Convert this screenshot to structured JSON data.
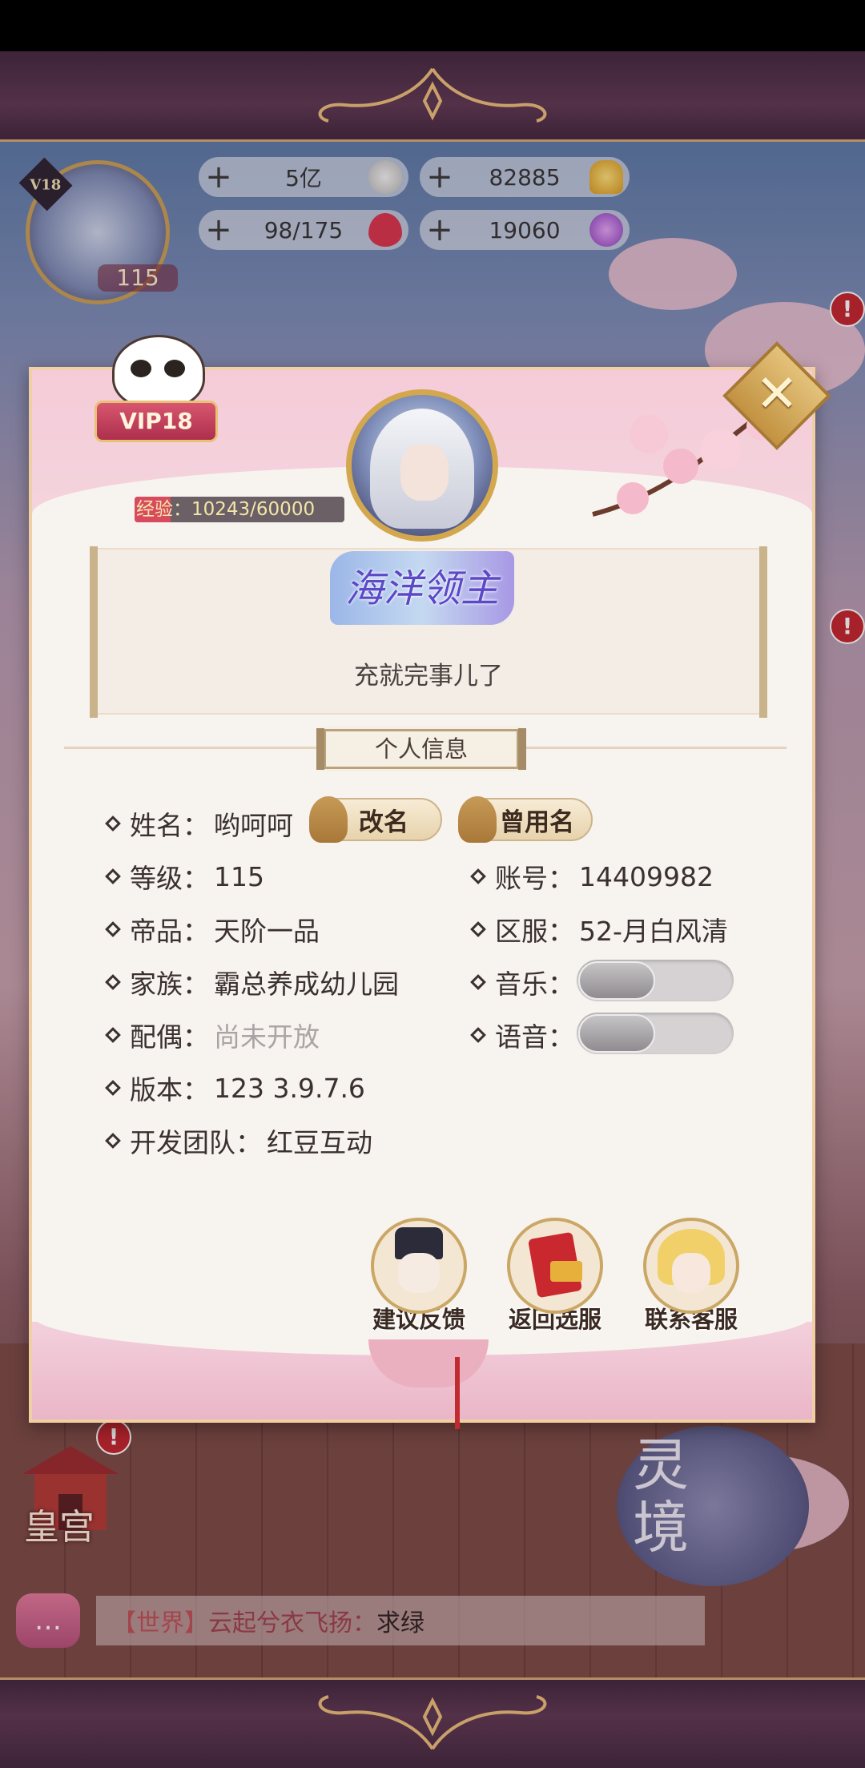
{
  "hud": {
    "vip": "V18",
    "level": "115",
    "resources": [
      {
        "value": "5亿",
        "icon": "silver-coin-icon",
        "color": "#d9d9d9"
      },
      {
        "value": "82885",
        "icon": "gold-ingot-icon",
        "color": "#e8b630"
      },
      {
        "value": "98/175",
        "icon": "heart-icon",
        "color": "#d9344a"
      },
      {
        "value": "19060",
        "icon": "purple-gem-icon",
        "color": "#9a4fc8"
      }
    ]
  },
  "panel": {
    "vip_badge": "VIP18",
    "exp_label": "经验：10243/60000",
    "exp_fraction": 0.17,
    "title_art": "海洋领主",
    "motto": "充就完事儿了",
    "section_title": "个人信息",
    "rename_button": "改名",
    "former_names_button": "曾用名",
    "info_left": [
      {
        "label": "姓名：",
        "value": "哟呵呵"
      },
      {
        "label": "等级：",
        "value": "115"
      },
      {
        "label": "帝品：",
        "value": "天阶一品"
      },
      {
        "label": "家族：",
        "value": "霸总养成幼儿园"
      },
      {
        "label": "配偶：",
        "value": "尚未开放"
      },
      {
        "label": "版本：",
        "value": "123 3.9.7.6"
      },
      {
        "label": "开发团队：",
        "value": "红豆互动"
      }
    ],
    "info_right": [
      {
        "label": "账号：",
        "value": "14409982"
      },
      {
        "label": "区服：",
        "value": "52-月白风清"
      },
      {
        "label": "音乐：",
        "toggle": "off"
      },
      {
        "label": "语音：",
        "toggle": "off"
      }
    ],
    "actions": [
      {
        "label": "建议反馈",
        "icon": "feedback-advisor-icon"
      },
      {
        "label": "返回选服",
        "icon": "server-select-book-icon"
      },
      {
        "label": "联系客服",
        "icon": "customer-service-icon"
      }
    ]
  },
  "background": {
    "palace_label": "皇宫",
    "spirit_label": "灵境",
    "chat_channel": "【世界】",
    "chat_sender": "云起兮衣飞扬：",
    "chat_text": "求绿"
  },
  "colors": {
    "accent_pink": "#f5cbd8",
    "gold": "#d2a74e",
    "alert_red": "#c2242c"
  }
}
